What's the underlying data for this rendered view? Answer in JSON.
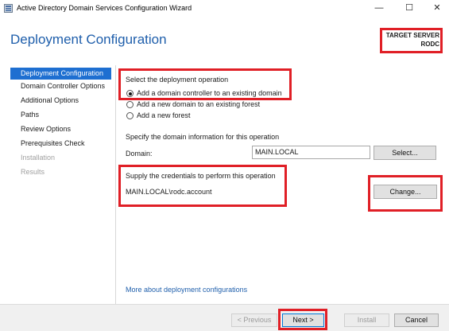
{
  "window": {
    "title": "Active Directory Domain Services Configuration Wizard",
    "minimize_glyph": "—",
    "maximize_glyph": "☐",
    "close_glyph": "✕"
  },
  "header": {
    "page_title": "Deployment Configuration",
    "target_server_label": "TARGET SERVER",
    "target_server_name": "RODC"
  },
  "sidebar": {
    "items": [
      {
        "label": "Deployment Configuration",
        "state": "active"
      },
      {
        "label": "Domain Controller Options",
        "state": "normal"
      },
      {
        "label": "Additional Options",
        "state": "normal"
      },
      {
        "label": "Paths",
        "state": "normal"
      },
      {
        "label": "Review Options",
        "state": "normal"
      },
      {
        "label": "Prerequisites Check",
        "state": "normal"
      },
      {
        "label": "Installation",
        "state": "disabled"
      },
      {
        "label": "Results",
        "state": "disabled"
      }
    ]
  },
  "main": {
    "operation_heading": "Select the deployment operation",
    "options": [
      {
        "label": "Add a domain controller to an existing domain",
        "checked": true
      },
      {
        "label": "Add a new domain to an existing forest",
        "checked": false
      },
      {
        "label": "Add a new forest",
        "checked": false
      }
    ],
    "domain_info_heading": "Specify the domain information for this operation",
    "domain_label": "Domain:",
    "domain_value": "MAIN.LOCAL",
    "select_button": "Select...",
    "credentials_heading": "Supply the credentials to perform this operation",
    "credentials_value": "MAIN.LOCAL\\rodc.account",
    "change_button": "Change...",
    "more_link": "More about deployment configurations"
  },
  "footer": {
    "previous_button": "< Previous",
    "next_button": "Next >",
    "install_button": "Install",
    "cancel_button": "Cancel"
  },
  "colors": {
    "accent": "#1e5eab",
    "selection": "#1e6fd1",
    "highlight_box": "#e01f26"
  }
}
